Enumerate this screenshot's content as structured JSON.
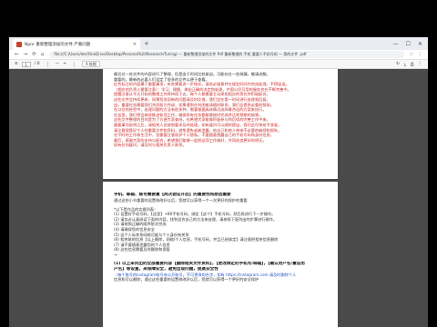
{
  "browser": {
    "tab_title": "Npnr 重新整理添加的文件 严重问题",
    "tab_close": "✕",
    "new_tab": "+",
    "window_controls": [
      "—",
      "☐",
      "✕"
    ],
    "nav": [
      "←",
      "→",
      "⟳",
      "⌂"
    ],
    "url": "file:///C:/Users/der/OneDrive/Desktop/Personal%20Research/Tuning/ — 重新整理添加的文件 Pdf 重新整理的 手机 重要人手机号码 — 我的文件 .pdf",
    "right_icons": [
      "☆",
      "⋮"
    ]
  },
  "pdf_toolbar": {
    "menu": "≡",
    "page_current": "1",
    "page_total": "/ 6",
    "zoom_out": "—",
    "zoom_in": "+",
    "draw_label": "A 绘图",
    "right_icons": [
      "↻",
      "⤓",
      "⎙",
      "⋮"
    ]
  },
  "page1": {
    "lines": [
      {
        "text": "最近对一些文件的内容进行了整理，但是由于时间比较紧迫，可能存在一些疏漏，敬请谅解。",
        "style": "normal"
      },
      {
        "text": "重要的，最新的必要人们设定了很多的文件以便于查看。",
        "style": "normal"
      },
      {
        "text": "红色标注的内容属于重要事项，有些需要进一步核实，请务必留意并在规定时间内完成处理，不得延误。",
        "style": "red"
      },
      {
        "text": "（相应的负责人需要注意）：学习、理解、做出正确的决定和处理，中国公民可用的服务也在不断完善中。",
        "style": "red"
      },
      {
        "text": "提醒注意从今天开始的整理工作将持续下去，每个人都需要主动承担相应的责任并积极配合。",
        "style": "red"
      },
      {
        "text": "这些文件会持续更新，如果您发现新的问题请及时反馈，我们会在第一时间进行处理和回复。",
        "style": "red"
      },
      {
        "text": "由，重要任务需要我们共同努力完成，如果遇到任何困难请随时联系，我们会提供必要的帮助。",
        "style": "red"
      },
      {
        "text": "在以往的经验中，处理问题的方法有很多种，需要根据具体情况选择最合适的方案来执行。",
        "style": "red"
      },
      {
        "text": "在这里，我们将会继续推进各项工作，确保所有任务都能够按时完成并达到预期的效果。",
        "style": "red"
      },
      {
        "text": "这些文件整理的目的是为了方便大家查阅，也希望大家能够积极参与到后续的完善工作中来。",
        "style": "red"
      },
      {
        "text": "重要事项说明之后，请相关人员按照要求及时处理，如有疑问可以随时提出，我们会尽快给予答复。",
        "style": "red"
      },
      {
        "text": "请注意保管好个人的重要文件和资料，避免遗失或者泄露，给自己和他人带来不必要的麻烦和损失。",
        "style": "red"
      },
      {
        "text": "在平时的工作和生活中，也需要注意保护个人隐私，不要随意透露自己的手机号码和身份信息。",
        "style": "red"
      },
      {
        "text": "最后，感谢大家的支持与配合，希望我们能够一起把这项工作做好，共同创造更好的明天。",
        "style": "red"
      },
      {
        "text": "如有任何疑问，请及时与相关负责人联系。",
        "style": "red"
      }
    ]
  },
  "page2": {
    "lines": [
      {
        "text": "手机、邮箱、账号需要重【两次验证开启】的重要性和原因重要",
        "style": "bold"
      },
      {
        "text": "通过这些小节重要的设置修改好以后，您就可以获得一个一次更好的保护的重要",
        "style": "normal"
      },
      {
        "text": "",
        "style": "gap"
      },
      {
        "text": "*以下是作品的实操列表：",
        "style": "normal"
      },
      {
        "text": "(1) 设置好手机号码，【这里】+86手机号码，绑定【这个】手机号码，然后再进行下一步操作。",
        "style": "normal"
      },
      {
        "text": "(2) 请务必认真阅读下面的内容，找到适合自己的方法来处理，请参照下面列出的步骤进行操作。",
        "style": "normal"
      },
      {
        "text": "(3) 请按照正确的顺序依次完成",
        "style": "normal"
      },
      {
        "text": "(4) 请确保您的信息安全",
        "style": "normal"
      },
      {
        "text": "(5) 这个人际关系网络可能与个人身份有关系",
        "style": "normal"
      },
      {
        "text": "(6) 相关联的信息【以上删除，网络/个人信息，手机号码，并且已经绑定】请注意把相关信息删除",
        "style": "normal"
      },
      {
        "text": "(7) 请不要随意泄露您的个人信息",
        "style": "normal"
      },
      {
        "text": "(8) 这些信息需要及时删除和保管",
        "style": "normal"
      },
      {
        "text": "→",
        "style": "normal"
      },
      {
        "text": "",
        "style": "gap"
      },
      {
        "text": "(1) 以上未列出的全部重要内容【删除相关文件资料】，【更改绑定的手机号/邮箱】，【确认用户名/重设用",
        "style": "bold"
      },
      {
        "text": "户名】等设置，来保障安全，避免出现问题，提高安全性",
        "style": "bold"
      },
      {
        "text": "（每个账号的instagram账号有公开账号，不可更改的名字，如有 https://instagram.com 请及时删除个人",
        "style": "link"
      },
      {
        "text": "信息和可以删除，通过这些重要的设置修改好以后，您就可以获得一个更好的安全保护",
        "style": "normal"
      }
    ]
  }
}
